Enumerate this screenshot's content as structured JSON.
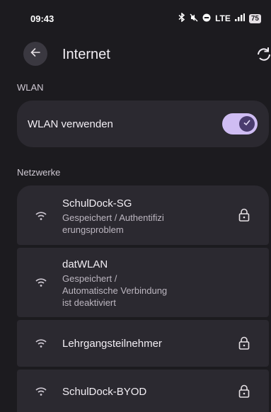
{
  "status": {
    "time": "09:43",
    "network": "LTE",
    "battery": "75"
  },
  "appbar": {
    "title": "Internet"
  },
  "wlan": {
    "section_label": "WLAN",
    "toggle_label": "WLAN verwenden",
    "enabled": true
  },
  "networks": {
    "section_label": "Netzwerke",
    "items": [
      {
        "name": "SchulDock-SG",
        "subtitle": "Gespeichert / Authentifizi\nerungsproblem",
        "locked": true
      },
      {
        "name": "datWLAN",
        "subtitle": "Gespeichert /\nAutomatische Verbindung\nist deaktiviert",
        "locked": false
      },
      {
        "name": "Lehrgangsteilnehmer",
        "subtitle": "",
        "locked": true
      },
      {
        "name": "SchulDock-BYOD",
        "subtitle": "",
        "locked": true
      }
    ]
  },
  "colors": {
    "background": "#1c1b1f",
    "card": "#2b2930",
    "switch_track": "#cfbdf3",
    "switch_thumb": "#4a3c6e"
  },
  "icons": [
    "arrow-back-icon",
    "sync-icon",
    "wifi-icon",
    "lock-icon",
    "check-icon",
    "bluetooth-icon",
    "mute-icon",
    "dnd-icon",
    "signal-icon",
    "battery-icon"
  ]
}
